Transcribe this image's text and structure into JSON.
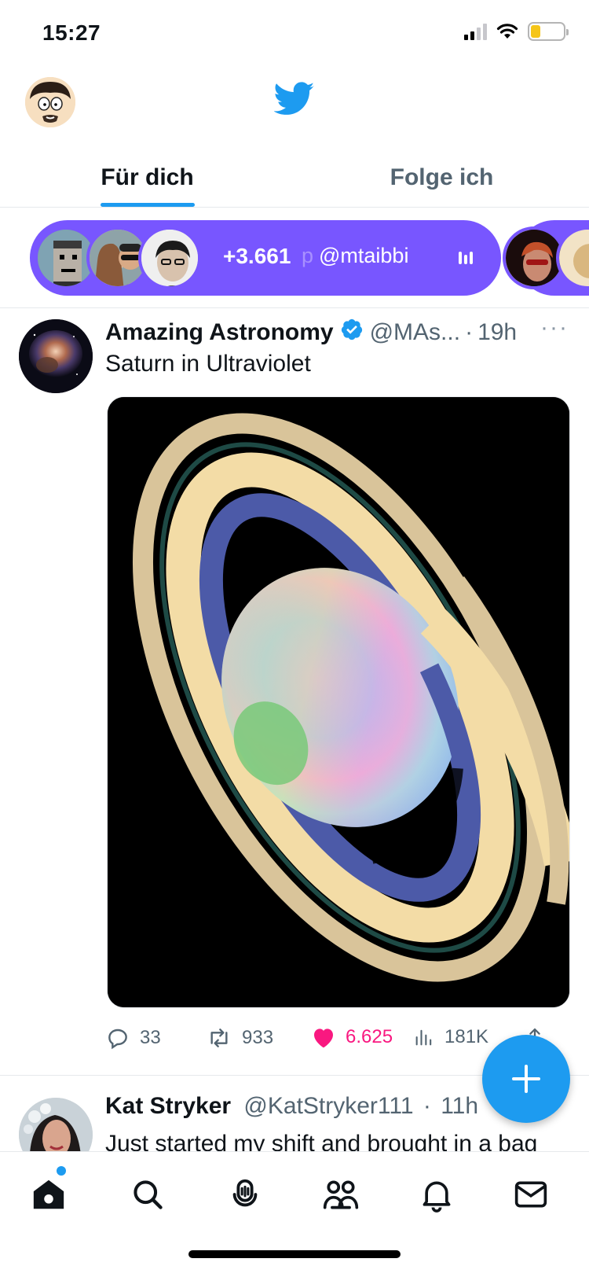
{
  "status_bar": {
    "time": "15:27"
  },
  "header": {
    "logo": "twitter-bird-icon"
  },
  "tabs": [
    {
      "label": "Für dich",
      "active": true
    },
    {
      "label": "Folge ich",
      "active": false
    }
  ],
  "space": {
    "listener_count": "+3.661",
    "fade_char": "p",
    "host": "@mtaibbi"
  },
  "tweet": {
    "name": "Amazing Astronomy",
    "handle": "@MAs...",
    "separator": "·",
    "time": "19h",
    "more": "···",
    "text": "Saturn in Ultraviolet",
    "replies": "33",
    "retweets": "933",
    "likes": "6.625",
    "views": "181K"
  },
  "tweet2": {
    "name": "Kat Stryker",
    "handle": "@KatStryker111",
    "separator": "·",
    "time": "11h",
    "text": "Just started my shift and brought in a bag"
  },
  "colors": {
    "accent": "#1d9bf0",
    "spaces": "#7856ff",
    "like": "#f91880",
    "muted": "#536471"
  }
}
